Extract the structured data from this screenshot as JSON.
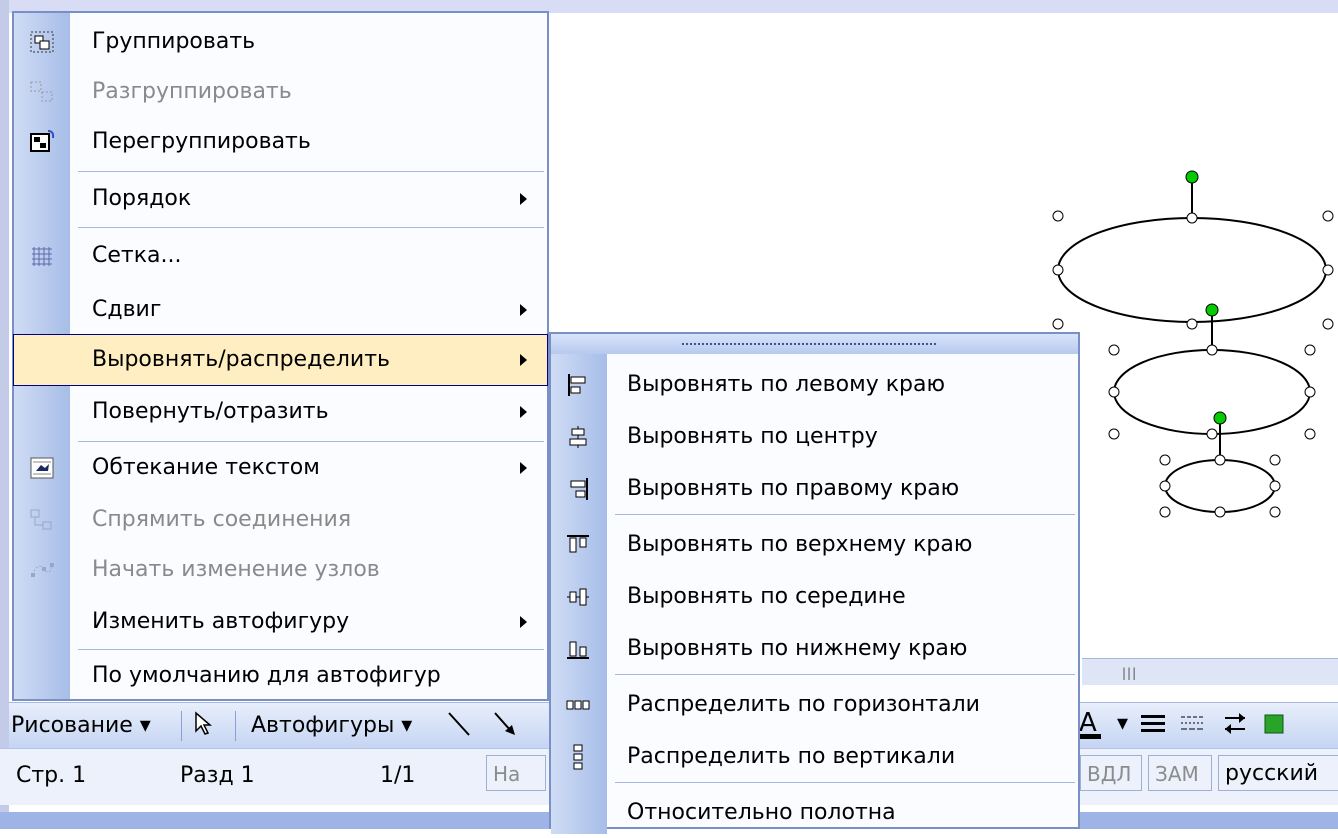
{
  "context_menu": {
    "items": [
      {
        "label": "Группировать",
        "icon": "group-icon",
        "disabled": false,
        "submenu": false
      },
      {
        "label": "Разгруппировать",
        "icon": "ungroup-icon",
        "disabled": true,
        "submenu": false
      },
      {
        "label": "Перегруппировать",
        "icon": "regroup-icon",
        "disabled": false,
        "submenu": false
      },
      {
        "label": "Порядок",
        "icon": "",
        "disabled": false,
        "submenu": true
      },
      {
        "label": "Сетка...",
        "icon": "grid-icon",
        "disabled": false,
        "submenu": false
      },
      {
        "label": "Сдвиг",
        "icon": "",
        "disabled": false,
        "submenu": true
      },
      {
        "label": "Выровнять/распределить",
        "icon": "",
        "disabled": false,
        "submenu": true,
        "highlighted": true
      },
      {
        "label": "Повернуть/отразить",
        "icon": "",
        "disabled": false,
        "submenu": true
      },
      {
        "label": "Обтекание текстом",
        "icon": "text-wrap-icon",
        "disabled": false,
        "submenu": true
      },
      {
        "label": "Спрямить соединения",
        "icon": "reroute-connectors-icon",
        "disabled": true,
        "submenu": false
      },
      {
        "label": "Начать изменение узлов",
        "icon": "edit-points-icon",
        "disabled": true,
        "submenu": false
      },
      {
        "label": "Изменить автофигуру",
        "icon": "",
        "disabled": false,
        "submenu": true
      },
      {
        "label": "По умолчанию для автофигур",
        "icon": "",
        "disabled": false,
        "submenu": false
      }
    ]
  },
  "align_submenu": {
    "items": [
      {
        "label": "Выровнять по левому краю",
        "icon": "align-left-icon"
      },
      {
        "label": "Выровнять по центру",
        "icon": "align-center-icon"
      },
      {
        "label": "Выровнять по правому краю",
        "icon": "align-right-icon"
      },
      {
        "label": "Выровнять по верхнему краю",
        "icon": "align-top-icon"
      },
      {
        "label": "Выровнять по середине",
        "icon": "align-middle-icon"
      },
      {
        "label": "Выровнять по нижнему краю",
        "icon": "align-bottom-icon"
      },
      {
        "label": "Распределить по горизонтали",
        "icon": "distribute-horizontal-icon"
      },
      {
        "label": "Распределить по вертикали",
        "icon": "distribute-vertical-icon"
      },
      {
        "label": "Относительно полотна",
        "icon": ""
      }
    ]
  },
  "drawing_toolbar": {
    "draw_label": "Рисование",
    "autoshapes_label": "Автофигуры"
  },
  "status_bar": {
    "page": "Стр. 1",
    "section": "Разд 1",
    "pages": "1/1",
    "at": "На",
    "ext": "ВДЛ",
    "ovr": "ЗАМ",
    "language": "русский"
  },
  "colors": {
    "highlight": "#ffeec2",
    "menu_border": "#7b8fc7",
    "handle_green": "#00cc00"
  }
}
